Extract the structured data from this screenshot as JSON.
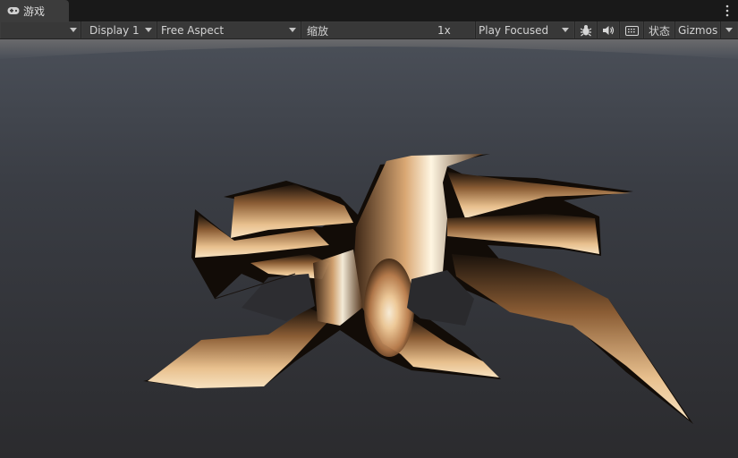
{
  "tab": {
    "label": "游戏",
    "icon": "gamepad-icon"
  },
  "toolbar": {
    "display": "Display 1",
    "aspect": "Free Aspect",
    "scale_label": "缩放",
    "scale_value": "1x",
    "play_mode": "Play Focused",
    "stats": "状态",
    "gizmos": "Gizmos"
  },
  "icons": {
    "tab": "gamepad-icon",
    "menu": "kebab-menu-icon",
    "bug": "bug-icon",
    "audio": "speaker-icon",
    "keyboard": "keyboard-icon"
  },
  "colors": {
    "background": "#1e1e1e",
    "toolbar": "#3c3c3c",
    "ground": "#2f3035",
    "crack_glow": "#fff4d8",
    "crack_edge": "#8a5a30"
  }
}
